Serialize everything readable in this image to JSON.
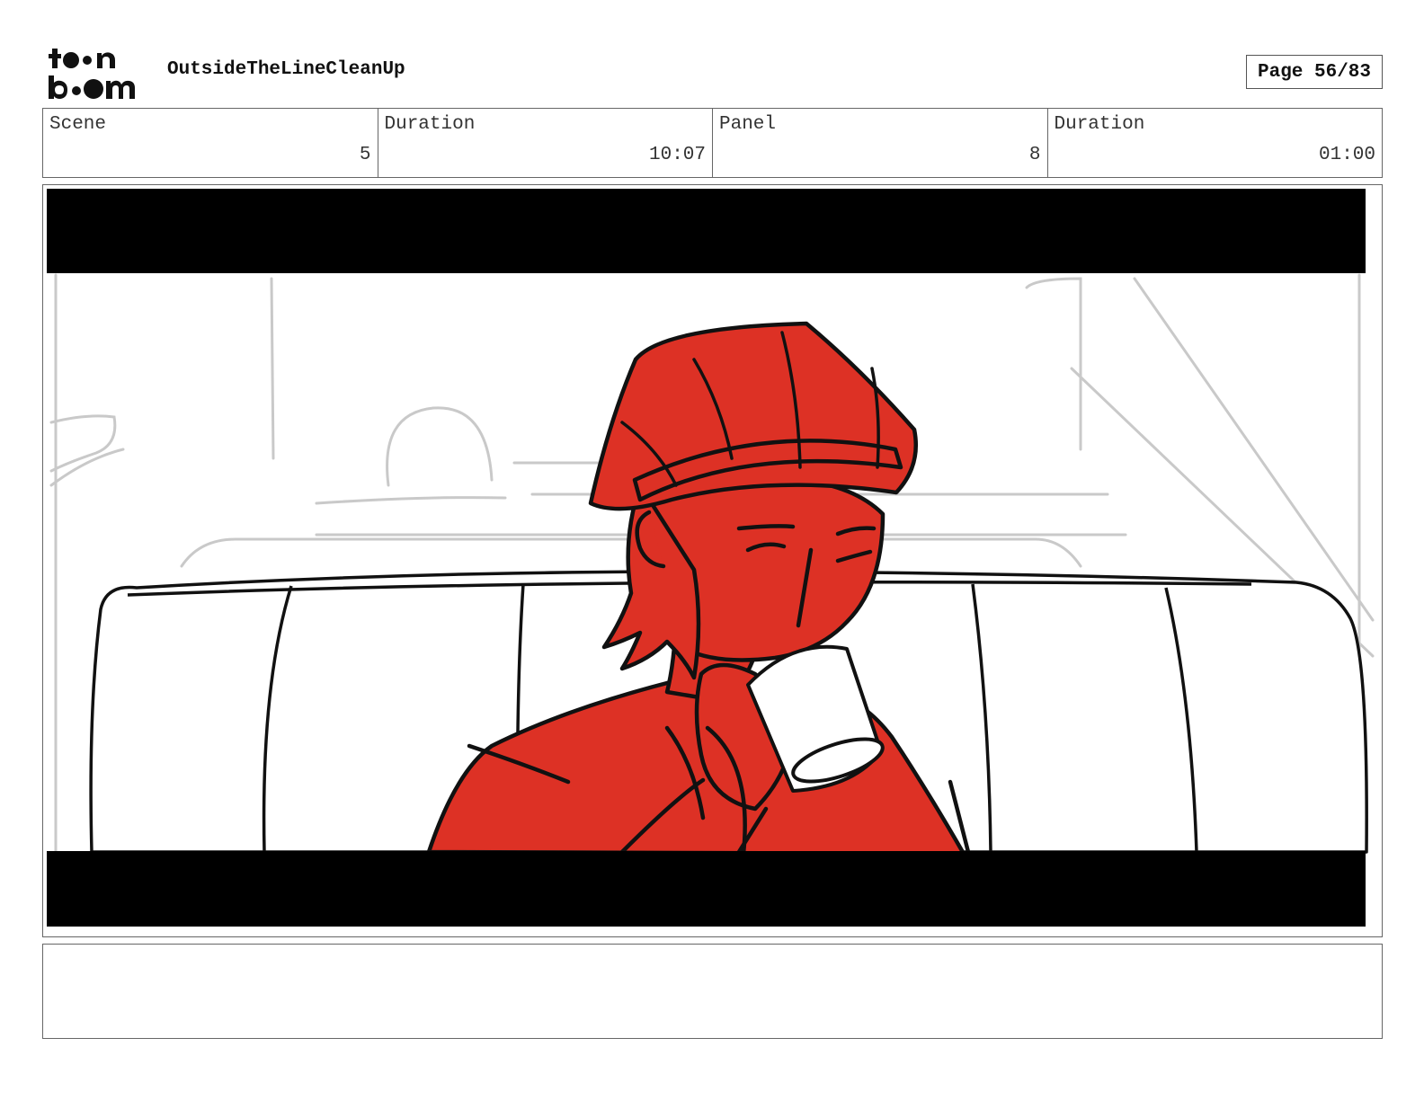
{
  "header": {
    "logo_text": "toon boom",
    "project_title": "OutsideTheLineCleanUp",
    "page_label": "Page 56/83"
  },
  "info": {
    "scene": {
      "label": "Scene",
      "value": "5"
    },
    "scene_duration": {
      "label": "Duration",
      "value": "10:07"
    },
    "panel": {
      "label": "Panel",
      "value": "8"
    },
    "panel_duration": {
      "label": "Duration",
      "value": "01:00"
    }
  },
  "panel_art": {
    "description_icon": "storyboard-sketch",
    "character_fill_color": "#dd3125",
    "letterbox_color": "#000000"
  },
  "notes": {
    "text": ""
  }
}
